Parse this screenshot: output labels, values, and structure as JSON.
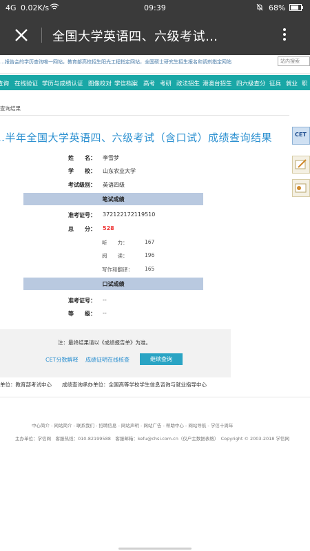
{
  "status": {
    "signal": "4G",
    "speed": "0.02K/s",
    "time": "09:39",
    "battery": "68%"
  },
  "titlebar": {
    "title": "全国大学英语四、六级考试…"
  },
  "site": {
    "topline": "…报告会的学历查询唯一网站，教育部高校招生阳光工程指定网站，全国硕士研究生招生报名和调剂指定网站",
    "search_placeholder": "站内搜索",
    "nav": [
      "查询",
      "在线验证",
      "学历与成绩认证",
      "图像校对",
      "学信档案",
      "高考",
      "考研",
      "政法招生",
      "港澳台招生",
      "四六级查分",
      "征兵",
      "就业",
      "职"
    ]
  },
  "breadcrumb": "查询结果",
  "page_title": "…半年全国大学英语四、六级考试（含口试）成绩查询结果",
  "candidate": {
    "name_label": "姓　　名：",
    "name": "李雪梦",
    "school_label": "学　　校：",
    "school": "山东农业大学",
    "level_label": "考试级别：",
    "level": "英语四级"
  },
  "written": {
    "header": "笔试成绩",
    "ticket_label": "准考证号：",
    "ticket": "372122172119510",
    "total_label": "总　　分：",
    "total": "528",
    "listening_label": "听　　力：",
    "listening": "167",
    "reading_label": "阅　　读：",
    "reading": "196",
    "writing_label": "写作和翻译：",
    "writing": "165"
  },
  "oral": {
    "header": "口试成绩",
    "ticket_label": "准考证号：",
    "ticket": "--",
    "grade_label": "等　　级：",
    "grade": "--"
  },
  "note": "注：最终结果请以《成绩报告单》为准。",
  "links": {
    "explain": "CET分数解释",
    "cert": "成绩证明在线核查",
    "continue": "继续查询"
  },
  "org": "单位：教育部考试中心　　成绩查询承办单位：全国高等学校学生信息咨询与就业指导中心",
  "footer": {
    "line1": "中心简介 - 网站简介 - 联系我们 - 招聘信息 - 网站声明 - 网站广告 - 帮助中心 - 网站导航 - 学信十周年",
    "line2": "主办单位：学信网　客服热线：010-82199588　客服邮箱：kefu@chsi.com.cn（仅户主数据表格）　Copyright © 2003-2018 学信网"
  }
}
